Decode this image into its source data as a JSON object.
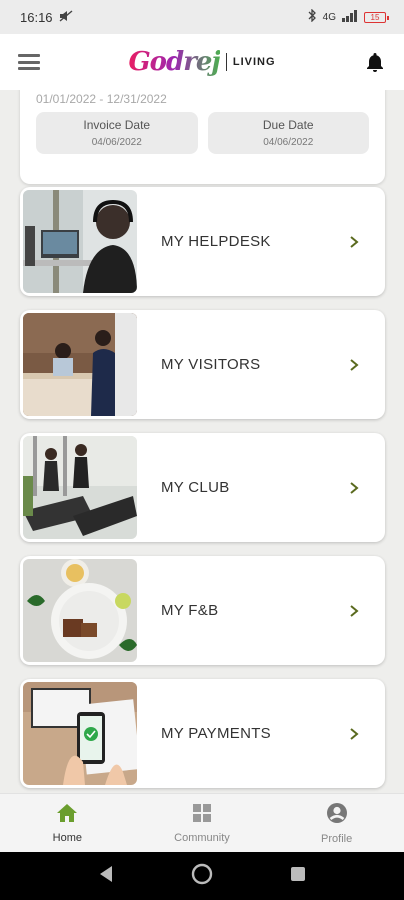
{
  "status_bar": {
    "time": "16:16",
    "network": "4G",
    "battery": "15"
  },
  "header": {
    "brand_logo": "Godrej",
    "brand_sub": "LIVING"
  },
  "invoice": {
    "date_range": "01/01/2022 - 12/31/2022",
    "invoice_date_label": "Invoice Date",
    "invoice_date_value": "04/06/2022",
    "due_date_label": "Due Date",
    "due_date_value": "04/06/2022"
  },
  "menu": [
    {
      "label": "MY HELPDESK"
    },
    {
      "label": "MY VISITORS"
    },
    {
      "label": "MY CLUB"
    },
    {
      "label": "MY F&B"
    },
    {
      "label": "MY PAYMENTS"
    }
  ],
  "bottom_nav": [
    {
      "label": "Home",
      "active": true
    },
    {
      "label": "Community"
    },
    {
      "label": "Profile"
    }
  ],
  "colors": {
    "accent": "#6b9e2e",
    "chevron": "#5a6a1e"
  },
  "icons": [
    "hamburger-icon",
    "bell-icon",
    "chevron-right-icon",
    "home-icon",
    "grid-icon",
    "profile-icon",
    "back-icon",
    "home-circle-icon",
    "recents-icon"
  ]
}
